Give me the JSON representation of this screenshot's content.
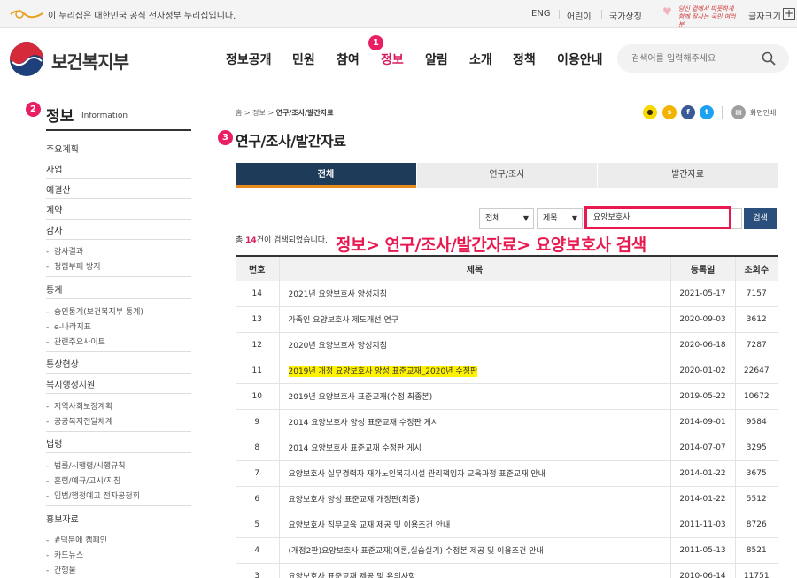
{
  "topbar": {
    "gov_notice": "이 누리집은 대한민국 공식 전자정부 누리집입니다.",
    "links": [
      "ENG",
      "어린이",
      "국가상징"
    ],
    "slogan": "당신 곁에서 따뜻하게 함께 잘사는 국민 여러분",
    "font_size_label": "글자크기",
    "font_plus": "+"
  },
  "header": {
    "ministry_name": "보건복지부",
    "gnb": [
      "정보공개",
      "민원",
      "참여",
      "정보",
      "알림",
      "소개",
      "정책",
      "이용안내"
    ],
    "active_gnb_index": 3,
    "search_placeholder": "검색어를 입력해주세요"
  },
  "badges": [
    "1",
    "2",
    "3"
  ],
  "sidebar": {
    "title": "정보",
    "subtitle": "Information",
    "items": [
      {
        "label": "주요계획"
      },
      {
        "label": "사업"
      },
      {
        "label": "예결산"
      },
      {
        "label": "계약"
      },
      {
        "label": "감사",
        "children": [
          "감사결과",
          "청렴부패 방지"
        ]
      },
      {
        "label": "통계",
        "children": [
          "승인통계(보건복지부 통계)",
          "e-나라지표",
          "관련주요사이트"
        ]
      },
      {
        "label": "통상협상"
      },
      {
        "label": "복지행정지원",
        "children": [
          "지역사회보장계획",
          "공공복지전달체계"
        ]
      },
      {
        "label": "법령",
        "children": [
          "법률/시행령/시행규칙",
          "훈령/예규/고시/지침",
          "입법/행정예고 전자공청회"
        ]
      },
      {
        "label": "홍보자료",
        "children": [
          "#덕분에 캠페인",
          "카드뉴스",
          "간행물"
        ]
      }
    ]
  },
  "breadcrumb": {
    "home": "홈",
    "level1": "정보",
    "current": "연구/조사/발간자료",
    "sep": ">"
  },
  "share": {
    "print_label": "화면인쇄",
    "icons": [
      "kakaotalk-icon",
      "kakaostory-icon",
      "facebook-icon",
      "twitter-icon",
      "print-icon"
    ]
  },
  "page_title": "연구/조사/발간자료",
  "tabs": [
    "전체",
    "연구/조사",
    "발간자료"
  ],
  "active_tab_index": 0,
  "filter": {
    "scope": "전체",
    "field": "제목",
    "keyword": "요양보호사",
    "button": "검색"
  },
  "count": {
    "prefix": "총 ",
    "number": "14",
    "suffix": "건이 검색되었습니다."
  },
  "annotation": "정보> 연구/조사/발간자료> 요양보호사 검색",
  "table": {
    "headers": [
      "번호",
      "제목",
      "등록일",
      "조회수"
    ],
    "rows": [
      {
        "no": "14",
        "title": "2021년 요양보호사 양성지침",
        "date": "2021-05-17",
        "views": "7157"
      },
      {
        "no": "13",
        "title": "가족인 요양보호사 제도개선 연구",
        "date": "2020-09-03",
        "views": "3612"
      },
      {
        "no": "12",
        "title": "2020년 요양보호사 양성지침",
        "date": "2020-06-18",
        "views": "7287"
      },
      {
        "no": "11",
        "title": "2019년 개정 요양보호사 양성 표준교재_2020년 수정판",
        "date": "2020-01-02",
        "views": "22647",
        "highlight": true
      },
      {
        "no": "10",
        "title": "2019년 요양보호사 표준교재(수정 최종본)",
        "date": "2019-05-22",
        "views": "10672"
      },
      {
        "no": "9",
        "title": "2014 요양보호사 양성 표준교재 수정판 게시",
        "date": "2014-09-01",
        "views": "9584"
      },
      {
        "no": "8",
        "title": "2014 요양보호사 표준교재 수정판 게시",
        "date": "2014-07-07",
        "views": "3295"
      },
      {
        "no": "7",
        "title": "요양보호사 실무경력자 재가노인복지시설 관리책임자 교육과정 표준교재 안내",
        "date": "2014-01-22",
        "views": "3675"
      },
      {
        "no": "6",
        "title": "요양보호사 양성 표준교재 개정판(최종)",
        "date": "2014-01-22",
        "views": "5512"
      },
      {
        "no": "5",
        "title": "요양보호사 직무교육 교재 제공 및 이용조건 안내",
        "date": "2011-11-03",
        "views": "8726"
      },
      {
        "no": "4",
        "title": "(개정2판)요양보호사 표준교재(이론,실습실기) 수정본 제공 및 이용조건 안내",
        "date": "2011-05-13",
        "views": "8521"
      },
      {
        "no": "3",
        "title": "요양보호사 표준교재 제공 및 유의사항",
        "date": "2010-06-14",
        "views": "11751"
      }
    ]
  },
  "colors": {
    "accent": "#e91e63",
    "tab_active": "#1f3b5a",
    "tab_underline": "#e88b1a",
    "search_button": "#2b4f7c",
    "highlight": "#fff200"
  }
}
